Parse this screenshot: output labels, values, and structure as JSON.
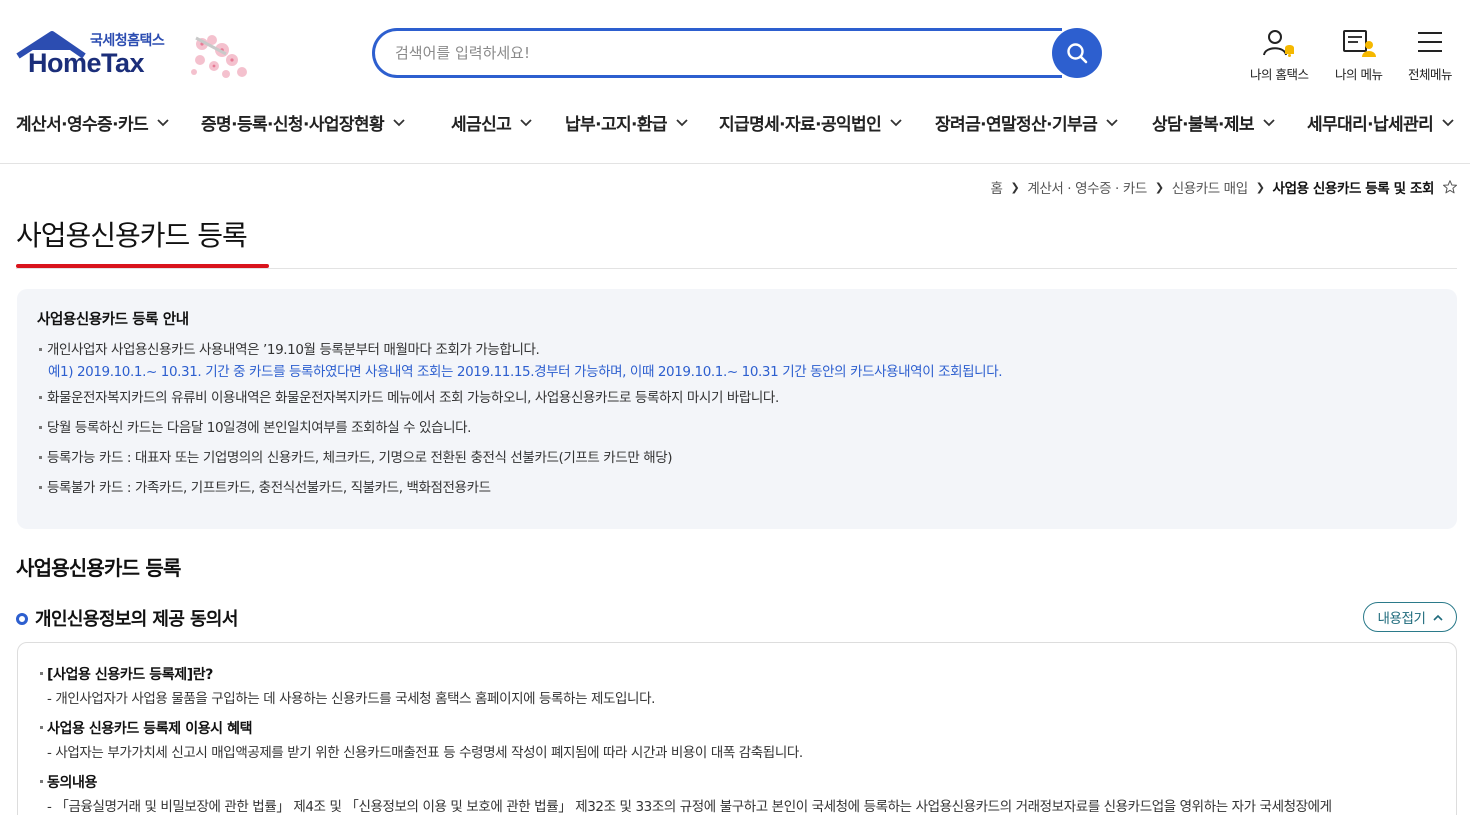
{
  "header": {
    "logo_sub": "국세청홈택스",
    "logo_main": "HomeTax",
    "search_placeholder": "검색어를 입력하세요!",
    "utils": [
      {
        "label": "나의 홈택스",
        "icon": "my-hometax-icon"
      },
      {
        "label": "나의 메뉴",
        "icon": "my-menu-icon"
      },
      {
        "label": "전체메뉴",
        "icon": "hamburger-menu-icon"
      }
    ],
    "accent_color": "#2d5fcf"
  },
  "gnb": [
    "계산서·영수증·카드",
    "증명·등록·신청·사업장현황",
    "세금신고",
    "납부·고지·환급",
    "지급명세·자료·공익법인",
    "장려금·연말정산·기부금",
    "상담·불복·제보",
    "세무대리·납세관리"
  ],
  "breadcrumb": [
    "홈",
    "계산서 · 영수증 · 카드",
    "신용카드 매입",
    "사업용 신용카드 등록 및 조회"
  ],
  "page_title": "사업용신용카드 등록",
  "info": {
    "title": "사업용신용카드 등록 안내",
    "line1": "개인사업자 사업용신용카드 사용내역은 ’19.10월 등록분부터 매월마다 조회가 가능합니다.",
    "example": "예1) 2019.10.1.~ 10.31. 기간 중 카드를 등록하였다면 사용내역 조회는 2019.11.15.경부터 가능하며, 이때 2019.10.1.~ 10.31 기간 동안의 카드사용내역이 조회됩니다.",
    "line2": "화물운전자복지카드의 유류비 이용내역은 화물운전자복지카드 메뉴에서 조회 가능하오니, 사업용신용카드로 등록하지 마시기 바랍니다.",
    "line3": "당월 등록하신 카드는 다음달 10일경에 본인일치여부를 조회하실 수 있습니다.",
    "line4": "등록가능 카드 : 대표자 또는 기업명의의 신용카드, 체크카드, 기명으로 전환된 충전식 선불카드(기프트 카드만 해당)",
    "line5": "등록불가 카드 : 가족카드, 기프트카드, 충전식선불카드, 직불카드, 백화점전용카드"
  },
  "section_title": "사업용신용카드 등록",
  "consent": {
    "title": "개인신용정보의 제공 동의서",
    "fold_label": "내용접기",
    "q1": "[사업용 신용카드 등록제]란?",
    "a1": "- 개인사업자가 사업용 물품을 구입하는 데 사용하는 신용카드를 국세청 홈택스 홈페이지에 등록하는 제도입니다.",
    "q2": "사업용 신용카드 등록제 이용시 혜택",
    "a2": "- 사업자는 부가가치세 신고시 매입액공제를 받기 위한 신용카드매출전표 등 수령명세 작성이 폐지됨에 따라 시간과 비용이 대폭 감축됩니다.",
    "q3": "동의내용",
    "a3": "- 「금융실명거래 및 비밀보장에 관한 법률」 제4조 및 「신용정보의 이용 및 보호에 관한 법률」 제32조 및 33조의 규정에 불구하고 본인이 국세청에 등록하는 사업용신용카드의   거래정보자료를 신용카드업을 영위하는 자가 국세청장에게"
  }
}
